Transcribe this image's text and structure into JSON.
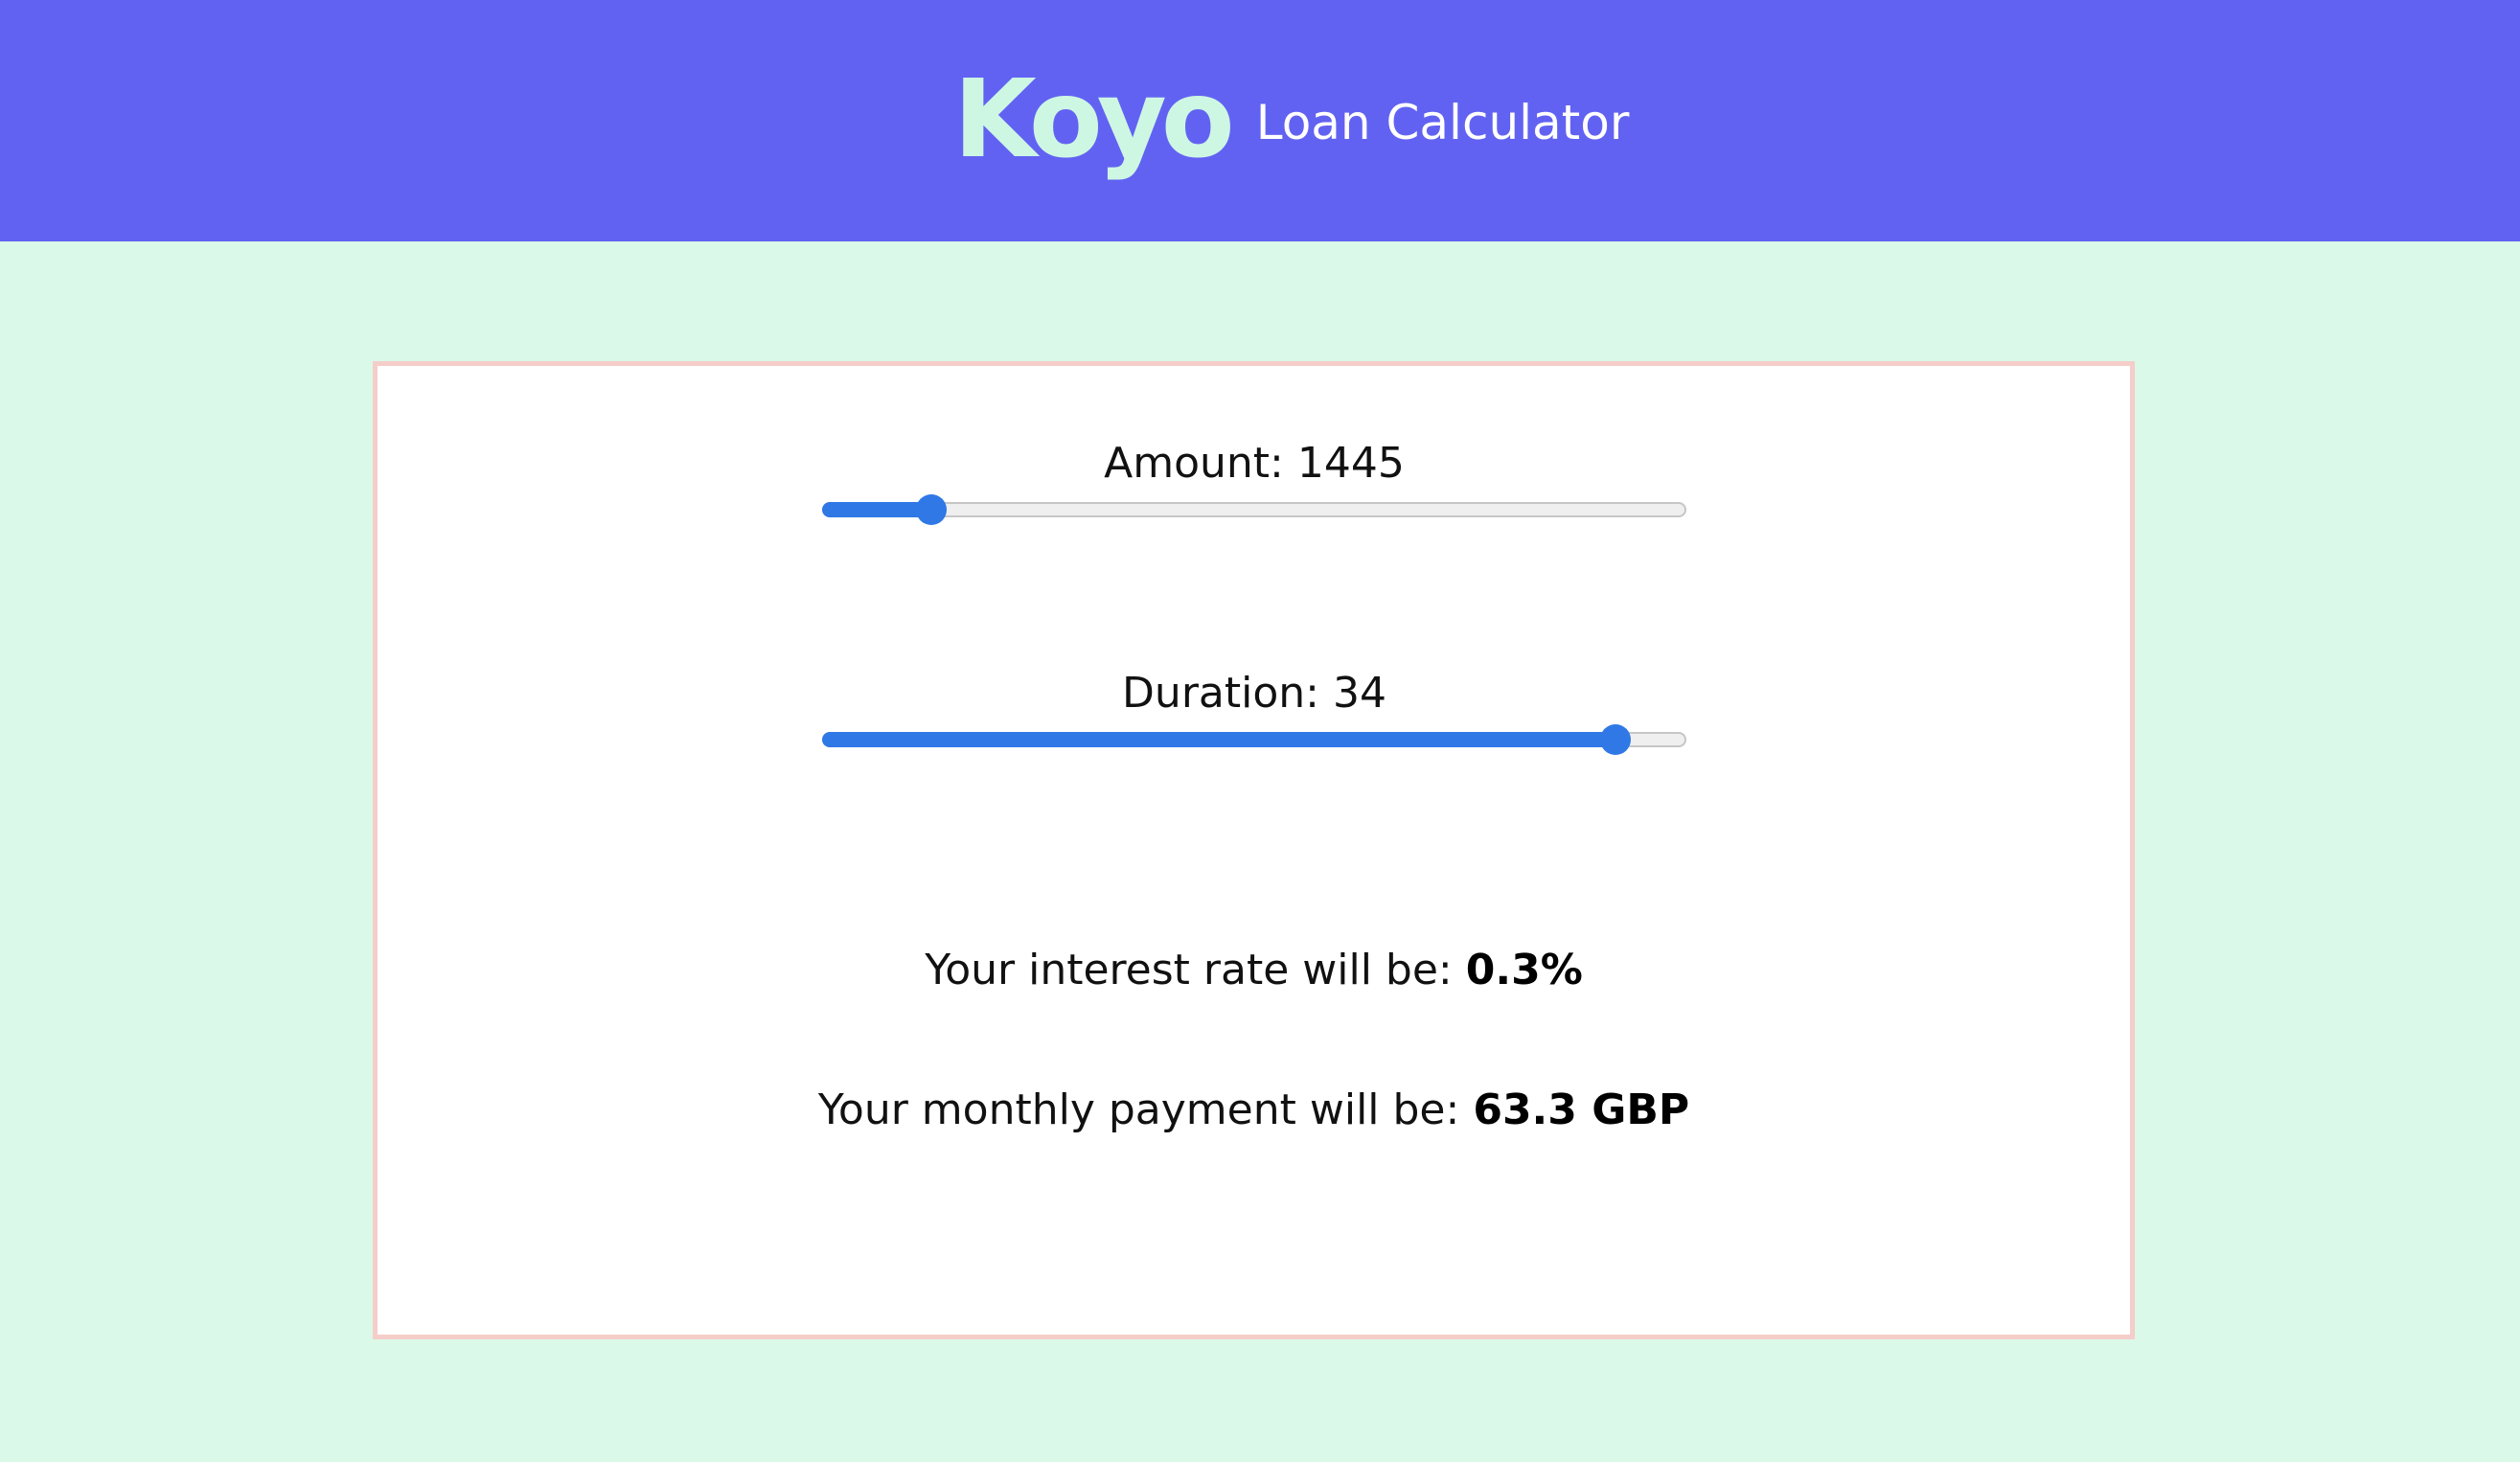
{
  "header": {
    "logo": "Koyo",
    "title": "Loan Calculator"
  },
  "amount": {
    "label": "Amount: 1445",
    "fraction": 0.125
  },
  "duration": {
    "label": "Duration: 34",
    "fraction": 0.92
  },
  "results": {
    "interest_label": "Your interest rate will be:",
    "interest_value": "0.3%",
    "payment_label": "Your monthly payment will be:",
    "payment_value": "63.3 GBP"
  },
  "colors": {
    "header_bg": "#6262f2",
    "page_bg": "#dbf9e8",
    "logo": "#cdf7e3",
    "accent": "#2f78e6",
    "card_border": "#f5cdc9"
  }
}
